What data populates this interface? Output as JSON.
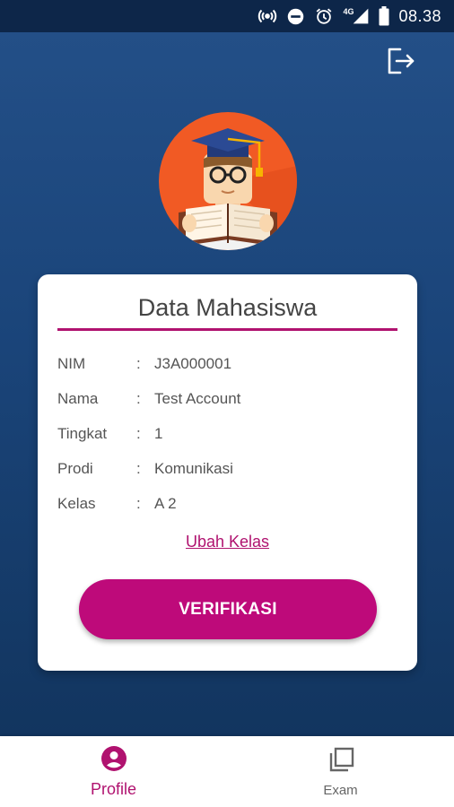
{
  "status_bar": {
    "network": "4G",
    "time": "08.38"
  },
  "header": {
    "logout_icon": "logout-icon"
  },
  "card": {
    "title": "Data Mahasiswa",
    "fields": [
      {
        "label": "NIM",
        "sep": ":",
        "value": "J3A000001"
      },
      {
        "label": "Nama",
        "sep": ":",
        "value": "Test Account"
      },
      {
        "label": "Tingkat",
        "sep": ":",
        "value": "1"
      },
      {
        "label": "Prodi",
        "sep": ":",
        "value": "Komunikasi"
      },
      {
        "label": "Kelas",
        "sep": ":",
        "value": "A 2"
      }
    ],
    "change_class_link": "Ubah Kelas",
    "verify_button": "VERIFIKASI"
  },
  "bottom_nav": {
    "items": [
      {
        "label": "Profile",
        "icon": "profile-icon",
        "active": true
      },
      {
        "label": "Exam",
        "icon": "exam-icon",
        "active": false
      }
    ]
  },
  "colors": {
    "accent": "#be0a7a",
    "background_top": "#234f87",
    "background_bottom": "#12355f"
  }
}
